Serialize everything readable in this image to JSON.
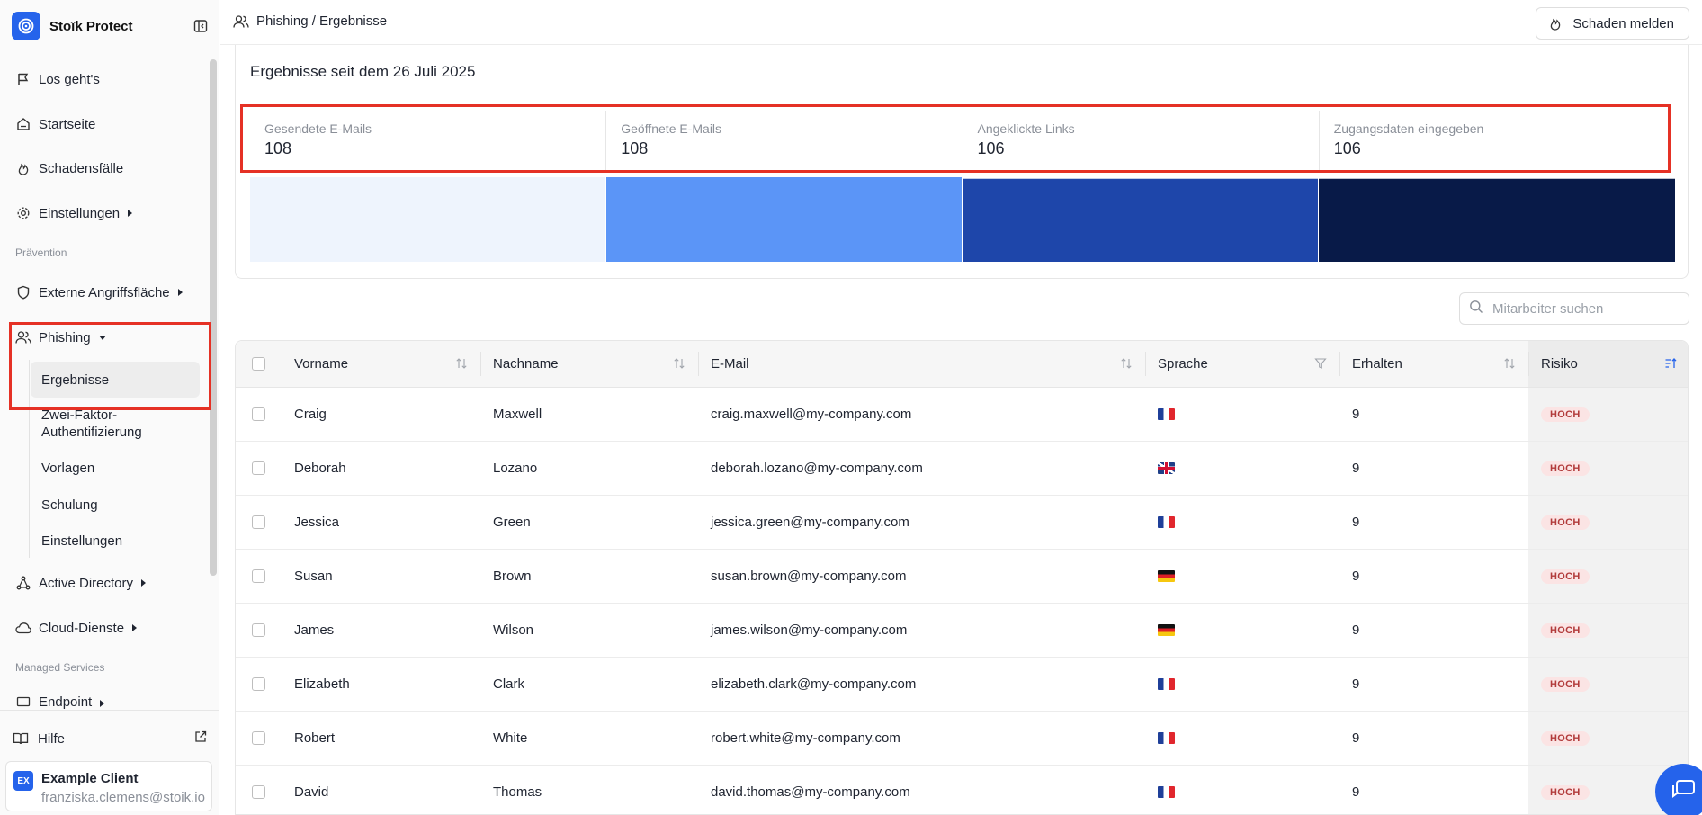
{
  "app": {
    "brand_name": "Stoïk Protect"
  },
  "sidebar": {
    "items": {
      "getting_started": "Los geht's",
      "home": "Startseite",
      "incidents": "Schadensfälle",
      "settings": "Einstellungen",
      "external_surface": "Externe Angriffsfläche",
      "phishing": "Phishing",
      "active_directory": "Active Directory",
      "cloud": "Cloud-Dienste",
      "endpoint": "Endpoint"
    },
    "sections": {
      "prevention": "Prävention",
      "managed": "Managed Services"
    },
    "phishing_sub": {
      "results": "Ergebnisse",
      "twofa": "Zwei-Faktor-Authentifizierung",
      "templates": "Vorlagen",
      "training": "Schulung",
      "settings": "Einstellungen"
    },
    "help": "Hilfe",
    "user": {
      "initials": "EX",
      "name": "Example Client",
      "email": "franziska.clemens@stoik.io"
    }
  },
  "header": {
    "breadcrumb": "Phishing / Ergebnisse",
    "report_button": "Schaden melden"
  },
  "results": {
    "title": "Ergebnisse seit dem 26 Juli 2025",
    "stats": [
      {
        "label": "Gesendete E-Mails",
        "value": "108",
        "color": "#eef4fd"
      },
      {
        "label": "Geöffnete E-Mails",
        "value": "108",
        "color": "#5b95f7"
      },
      {
        "label": "Angeklickte Links",
        "value": "106",
        "color": "#1e46aa"
      },
      {
        "label": "Zugangsdaten eingegeben",
        "value": "106",
        "color": "#081a48"
      }
    ]
  },
  "search": {
    "placeholder": "Mitarbeiter suchen"
  },
  "table": {
    "columns": {
      "first": "Vorname",
      "last": "Nachname",
      "email": "E-Mail",
      "lang": "Sprache",
      "received": "Erhalten",
      "risk": "Risiko"
    },
    "rows": [
      {
        "first": "Craig",
        "last": "Maxwell",
        "email": "craig.maxwell@my-company.com",
        "flag": "fr",
        "received": "9",
        "risk": "HOCH"
      },
      {
        "first": "Deborah",
        "last": "Lozano",
        "email": "deborah.lozano@my-company.com",
        "flag": "gb",
        "received": "9",
        "risk": "HOCH"
      },
      {
        "first": "Jessica",
        "last": "Green",
        "email": "jessica.green@my-company.com",
        "flag": "fr",
        "received": "9",
        "risk": "HOCH"
      },
      {
        "first": "Susan",
        "last": "Brown",
        "email": "susan.brown@my-company.com",
        "flag": "de",
        "received": "9",
        "risk": "HOCH"
      },
      {
        "first": "James",
        "last": "Wilson",
        "email": "james.wilson@my-company.com",
        "flag": "de",
        "received": "9",
        "risk": "HOCH"
      },
      {
        "first": "Elizabeth",
        "last": "Clark",
        "email": "elizabeth.clark@my-company.com",
        "flag": "fr",
        "received": "9",
        "risk": "HOCH"
      },
      {
        "first": "Robert",
        "last": "White",
        "email": "robert.white@my-company.com",
        "flag": "fr",
        "received": "9",
        "risk": "HOCH"
      },
      {
        "first": "David",
        "last": "Thomas",
        "email": "david.thomas@my-company.com",
        "flag": "fr",
        "received": "9",
        "risk": "HOCH"
      }
    ]
  },
  "colors": {
    "accent": "#2563eb",
    "highlight": "#e53125",
    "risk_bg": "#fbe4e4",
    "risk_text": "#b23b3b"
  }
}
